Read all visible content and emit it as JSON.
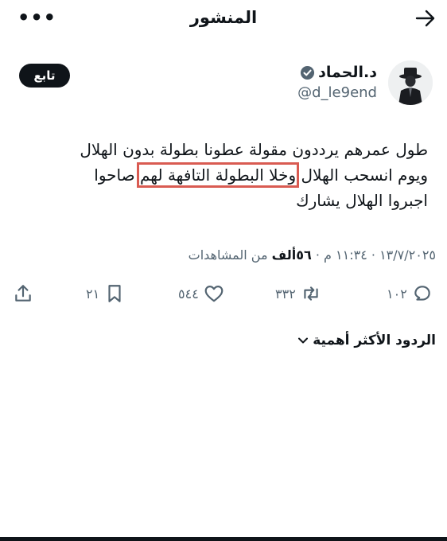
{
  "header": {
    "title": "المنشور",
    "menu_icon": "more-horizontal-icon",
    "back_icon": "arrow-right-icon"
  },
  "author": {
    "name": "د.الحماد",
    "handle": "@d_le9end",
    "verified": true,
    "follow_label": "تابع"
  },
  "tweet": {
    "line1": "طول عمرهم يرددون مقولة عطونا بطولة بدون الهلال",
    "line2_before": "ويوم انسحب الهلال ",
    "line2_highlight": "وخلا البطولة التافهة لهم",
    "line2_after": " صاحوا",
    "line3": "اجبروا الهلال يشارك",
    "highlight_color": "#d95b52"
  },
  "meta": {
    "date": "١٣/٧/٢٠٢٥",
    "time": "١١:٣٤ م",
    "views_count": "٥٦ألف",
    "views_label": "من المشاهدات",
    "separator": "·"
  },
  "actions": {
    "replies": "١٠٢",
    "reposts": "٣٣٢",
    "likes": "٥٤٤",
    "bookmarks": "٢١"
  },
  "replies_sort": {
    "label": "الردود الأكثر أهمية"
  }
}
